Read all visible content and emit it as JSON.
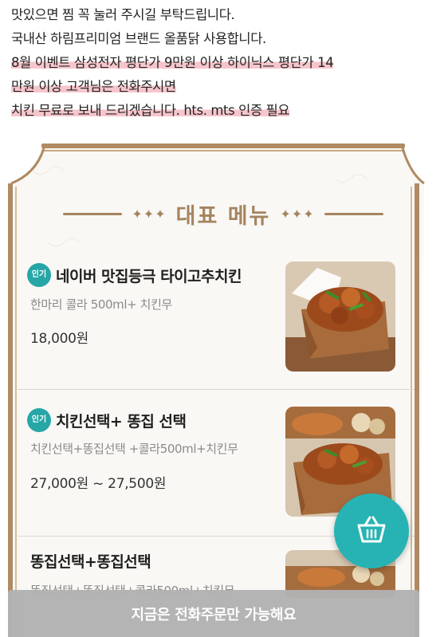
{
  "notice": {
    "line1": "맛있으면 찜 꼭 눌러 주시길 부탁드립니다.",
    "line2": "국내산 하림프리미엄 브랜드 올품닭 사용합니다.",
    "line3": "8월 이벤트 삼성전자 평단가 9만원 이상 하이닉스 평단가 14",
    "line4": "만원 이상 고객님은 전화주시면",
    "line5": "치킨 무료로 보내 드리겠습니다. hts. mts 인증 필요"
  },
  "section": {
    "title": "대표 메뉴",
    "title_deco_left": "✦✦✦",
    "title_deco_right": "✦✦✦"
  },
  "menu_items": [
    {
      "badge": "인기",
      "name": "네이버 맛집등극 타이고추치킨",
      "desc": "한마리 콜라 500ml+ 치킨무",
      "price": "18,000원"
    },
    {
      "badge": "인기",
      "name": "치킨선택+ 똥집 선택",
      "desc": "치킨선택+똥집선택 +콜라500ml+치킨무",
      "price": "27,000원 ~ 27,500원"
    },
    {
      "name": "똥집선택+똥집선택",
      "desc": "똥집선택+똥집선택+콜라500ml+치킨무"
    }
  ],
  "order_bar": {
    "label": "지금은 전화주문만 가능해요"
  },
  "icons": {
    "cart": "basket-icon"
  },
  "colors": {
    "accent": "#27b3b4",
    "gold": "#a5845f",
    "highlight": "#ee96a0",
    "order_bar": "#b2b2b2"
  }
}
